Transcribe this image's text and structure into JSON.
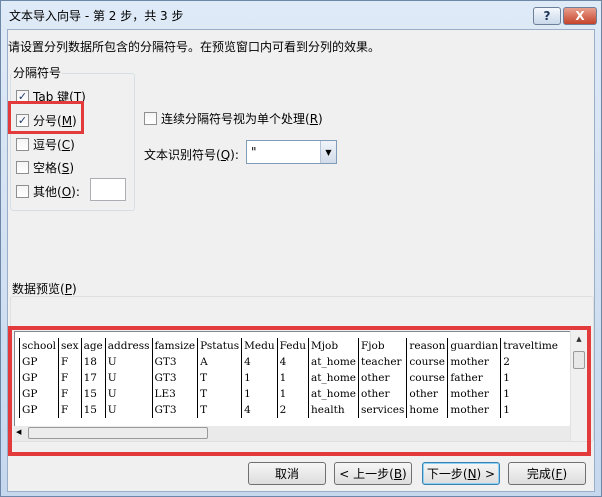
{
  "window": {
    "title": "文本导入向导 - 第 2 步，共 3 步",
    "help": "?",
    "close": "X"
  },
  "instruction": "请设置分列数据所包含的分隔符号。在预览窗口内可看到分列的效果。",
  "delimiters": {
    "group_label": "分隔符号",
    "tab": {
      "label": "Tab 键(",
      "key": "T",
      "end": ")",
      "checked": true
    },
    "semicolon": {
      "label": "分号(",
      "key": "M",
      "end": ")",
      "checked": true
    },
    "comma": {
      "label": "逗号(",
      "key": "C",
      "end": ")",
      "checked": false
    },
    "space": {
      "label": "空格(",
      "key": "S",
      "end": ")",
      "checked": false
    },
    "other": {
      "label": "其他(",
      "key": "O",
      "end": "):",
      "checked": false,
      "value": ""
    }
  },
  "consecutive": {
    "label": "连续分隔符号视为单个处理(",
    "key": "R",
    "end": ")",
    "checked": false
  },
  "text_qualifier": {
    "label": "文本识别符号(",
    "key": "Q",
    "end": "):",
    "value": "\""
  },
  "preview": {
    "label": "数据预览(",
    "key": "P",
    "end": ")",
    "rows": [
      [
        "school",
        "sex",
        "age",
        "address",
        "famsize",
        "Pstatus",
        "Medu",
        "Fedu",
        "Mjob",
        "Fjob",
        "reason",
        "guardian",
        "traveltime"
      ],
      [
        "GP",
        "F",
        "18",
        "U",
        "GT3",
        "A",
        "4",
        "4",
        "at_home",
        "teacher",
        "course",
        "mother",
        "2"
      ],
      [
        "GP",
        "F",
        "17",
        "U",
        "GT3",
        "T",
        "1",
        "1",
        "at_home",
        "other",
        "course",
        "father",
        "1"
      ],
      [
        "GP",
        "F",
        "15",
        "U",
        "LE3",
        "T",
        "1",
        "1",
        "at_home",
        "other",
        "other",
        "mother",
        "1"
      ],
      [
        "GP",
        "F",
        "15",
        "U",
        "GT3",
        "T",
        "4",
        "2",
        "health",
        "services",
        "home",
        "mother",
        "1"
      ]
    ]
  },
  "buttons": {
    "cancel": "取消",
    "back": "< 上一步(",
    "back_key": "B",
    "back_end": ")",
    "next": "下一步(",
    "next_key": "N",
    "next_end": ") >",
    "finish": "完成(",
    "finish_key": "F",
    "finish_end": ")"
  }
}
